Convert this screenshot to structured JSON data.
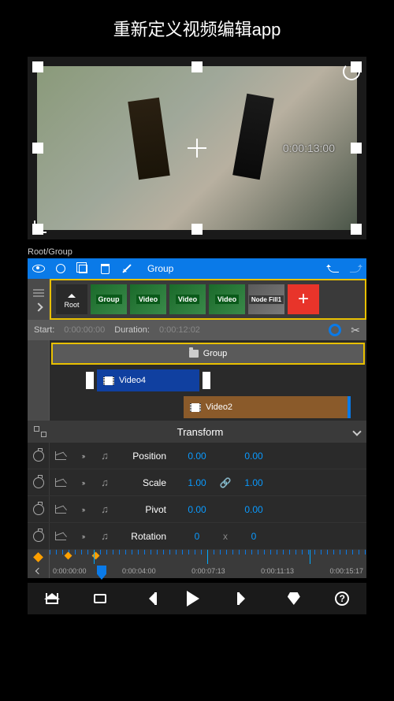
{
  "header": {
    "title": "重新定义视频编辑app"
  },
  "preview": {
    "timecode": "0:00:13:00"
  },
  "breadcrumb": "Root/Group",
  "toolbar": {
    "label": "Group"
  },
  "layers": {
    "root_label": "Root",
    "thumbs": [
      {
        "label": "Group"
      },
      {
        "label": "Video"
      },
      {
        "label": "Video"
      },
      {
        "label": "Video"
      },
      {
        "label": "Node Fill1"
      }
    ]
  },
  "timeline": {
    "start_label": "Start:",
    "start_value": "0:00:00:00",
    "duration_label": "Duration:",
    "duration_value": "0:00:12:02"
  },
  "tracks": {
    "group_label": "Group",
    "video4_label": "Video4",
    "video2_label": "Video2"
  },
  "transform": {
    "title": "Transform",
    "rows": [
      {
        "label": "Position",
        "v1": "0.00",
        "v2": "0.00",
        "link": ""
      },
      {
        "label": "Scale",
        "v1": "1.00",
        "v2": "1.00",
        "link": "🔗"
      },
      {
        "label": "Pivot",
        "v1": "0.00",
        "v2": "0.00",
        "link": ""
      },
      {
        "label": "Rotation",
        "v1": "0",
        "v2": "0",
        "link": "x"
      }
    ]
  },
  "timecodes": [
    "0:00:00:00",
    "0:00:04:00",
    "0:00:07:13",
    "0:00:11:13",
    "0:00:15:17"
  ]
}
